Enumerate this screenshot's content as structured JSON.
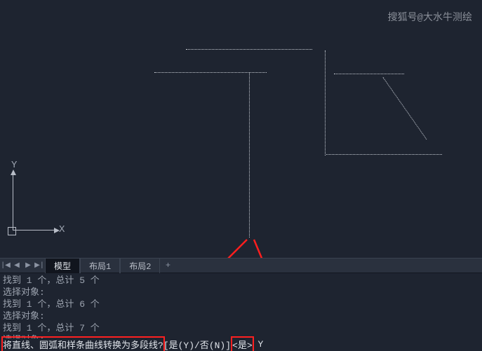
{
  "watermark": "搜狐号@大水牛测绘",
  "axes": {
    "x": "X",
    "y": "Y"
  },
  "tabs": {
    "items": [
      {
        "label": "模型",
        "active": true
      },
      {
        "label": "布局1",
        "active": false
      },
      {
        "label": "布局2",
        "active": false
      }
    ],
    "add_label": "+"
  },
  "nav_icons": {
    "first": "|◀",
    "prev": "◀",
    "next": "▶",
    "last": "▶|"
  },
  "command_history": [
    "找到 1 个，总计 5 个",
    "选择对象:",
    "找到 1 个，总计 6 个",
    "选择对象:",
    "找到 1 个，总计 7 个",
    "选择对象:"
  ],
  "prompt": {
    "question": "将直线、圆弧和样条曲线转换为多段线?",
    "options": "[是(Y)/否(N)]",
    "default": "<是>",
    "input": " Y"
  }
}
